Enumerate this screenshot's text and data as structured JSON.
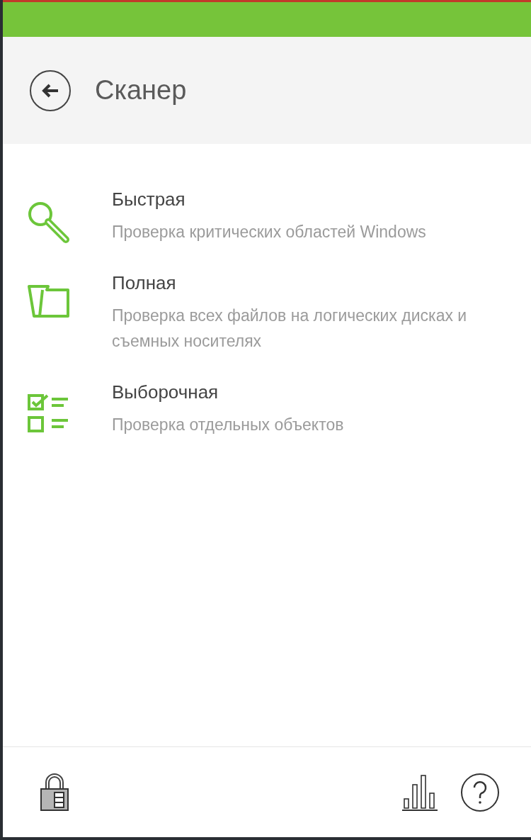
{
  "header": {
    "title": "Сканер"
  },
  "scan_options": [
    {
      "kind": "quick",
      "title": "Быстрая",
      "description": "Проверка критических областей Windows"
    },
    {
      "kind": "full",
      "title": "Полная",
      "description": "Проверка всех файлов на логических дисках и съемных носителях"
    },
    {
      "kind": "custom",
      "title": "Выборочная",
      "description": "Проверка отдельных объектов"
    }
  ]
}
